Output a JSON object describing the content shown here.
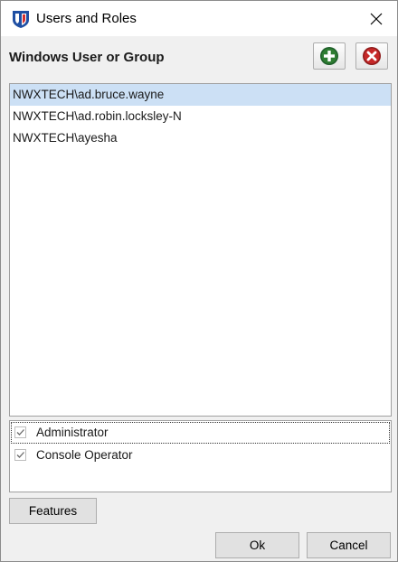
{
  "window": {
    "title": "Users and Roles",
    "app_icon": "shield-logo-icon",
    "close_icon": "close-icon"
  },
  "panel": {
    "title": "Windows User or Group",
    "add_icon": "plus-circle-icon",
    "remove_icon": "x-circle-icon",
    "colors": {
      "add": "#2e7d32",
      "remove": "#c62828"
    }
  },
  "users": [
    {
      "name": "NWXTECH\\ad.bruce.wayne",
      "selected": true
    },
    {
      "name": "NWXTECH\\ad.robin.locksley-N",
      "selected": false
    },
    {
      "name": "NWXTECH\\ayesha",
      "selected": false
    }
  ],
  "roles": [
    {
      "label": "Administrator",
      "checked": true
    },
    {
      "label": "Console Operator",
      "checked": true
    }
  ],
  "buttons": {
    "features": "Features",
    "ok": "Ok",
    "cancel": "Cancel"
  },
  "colors": {
    "selection": "#cce0f5",
    "window_bg": "#f0f0f0"
  }
}
